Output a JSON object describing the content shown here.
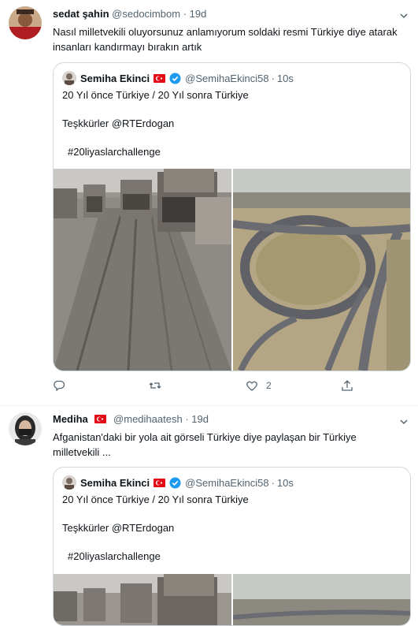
{
  "tweets": [
    {
      "author": {
        "name": "sedat şahin",
        "handle": "@sedocimbom",
        "time": "19d",
        "has_flag": false
      },
      "text_lines": [
        "Nasıl milletvekili oluyorsunuz anlamıyorum  soldaki resmi Türkiye diye atarak",
        "insanları kandırmayı bırakın artık"
      ],
      "quote": {
        "author": {
          "name": "Semiha Ekinci",
          "handle": "@SemihaEkinci58",
          "time": "10s"
        },
        "line1": "20 Yıl önce Türkiye  /   20 Yıl sonra Türkiye",
        "line2": "Teşkkürler @RTErdogan",
        "line3": "#20liyaslarchallenge"
      },
      "actions": {
        "reply": "",
        "retweet": "",
        "like": "2",
        "share": ""
      }
    },
    {
      "author": {
        "name": "Mediha",
        "handle": "@medihaatesh",
        "time": "19d",
        "has_flag": true
      },
      "text_lines": [
        "Afganistan'daki bir yola ait görseli Türkiye diye paylaşan bir Türkiye",
        "milletvekili ..."
      ],
      "quote": {
        "author": {
          "name": "Semiha Ekinci",
          "handle": "@SemihaEkinci58",
          "time": "10s"
        },
        "line1": "20 Yıl önce Türkiye  /   20 Yıl sonra Türkiye",
        "line2": "Teşkkürler @RTErdogan",
        "line3": "#20liyaslarchallenge"
      }
    }
  ],
  "separator": "·",
  "icons": [
    "chevron-down-icon",
    "turkish-flag-icon",
    "verified-badge-icon",
    "reply-icon",
    "retweet-icon",
    "like-icon",
    "share-icon"
  ],
  "colors": {
    "text": "#0f1419",
    "secondary": "#536471",
    "verified": "#1d9bf0",
    "flag": "#e30a17",
    "border": "#cfd9de"
  }
}
